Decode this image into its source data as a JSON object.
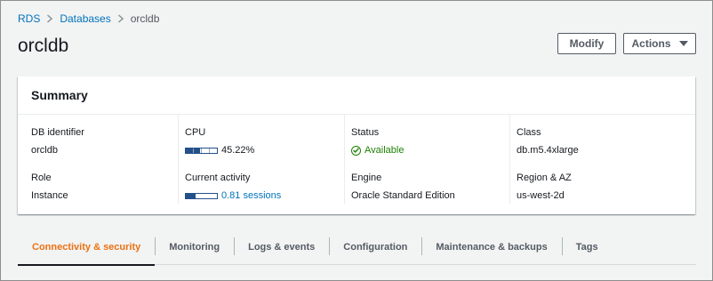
{
  "breadcrumb": {
    "items": [
      "RDS",
      "Databases"
    ],
    "current": "orcldb"
  },
  "page": {
    "title": "orcldb"
  },
  "header_actions": {
    "modify_label": "Modify",
    "actions_label": "Actions"
  },
  "summary": {
    "title": "Summary",
    "db_identifier": {
      "label": "DB identifier",
      "value": "orcldb"
    },
    "role": {
      "label": "Role",
      "value": "Instance"
    },
    "cpu": {
      "label": "CPU",
      "value": "45.22%",
      "fill_fraction": 0.4522
    },
    "current_activity": {
      "label": "Current activity",
      "value": "0.81 sessions",
      "fill_fraction": 0.3
    },
    "status": {
      "label": "Status",
      "value": "Available",
      "icon": "check-circle-icon"
    },
    "engine": {
      "label": "Engine",
      "value": "Oracle Standard Edition"
    },
    "class": {
      "label": "Class",
      "value": "db.m5.4xlarge"
    },
    "region": {
      "label": "Region & AZ",
      "value": "us-west-2d"
    }
  },
  "tabs": [
    {
      "label": "Connectivity & security",
      "active": true
    },
    {
      "label": "Monitoring"
    },
    {
      "label": "Logs & events"
    },
    {
      "label": "Configuration"
    },
    {
      "label": "Maintenance & backups"
    },
    {
      "label": "Tags"
    }
  ],
  "colors": {
    "link": "#0073bb",
    "success": "#1d8102",
    "active_tab": "#ec7211",
    "meter": "#24508a"
  }
}
